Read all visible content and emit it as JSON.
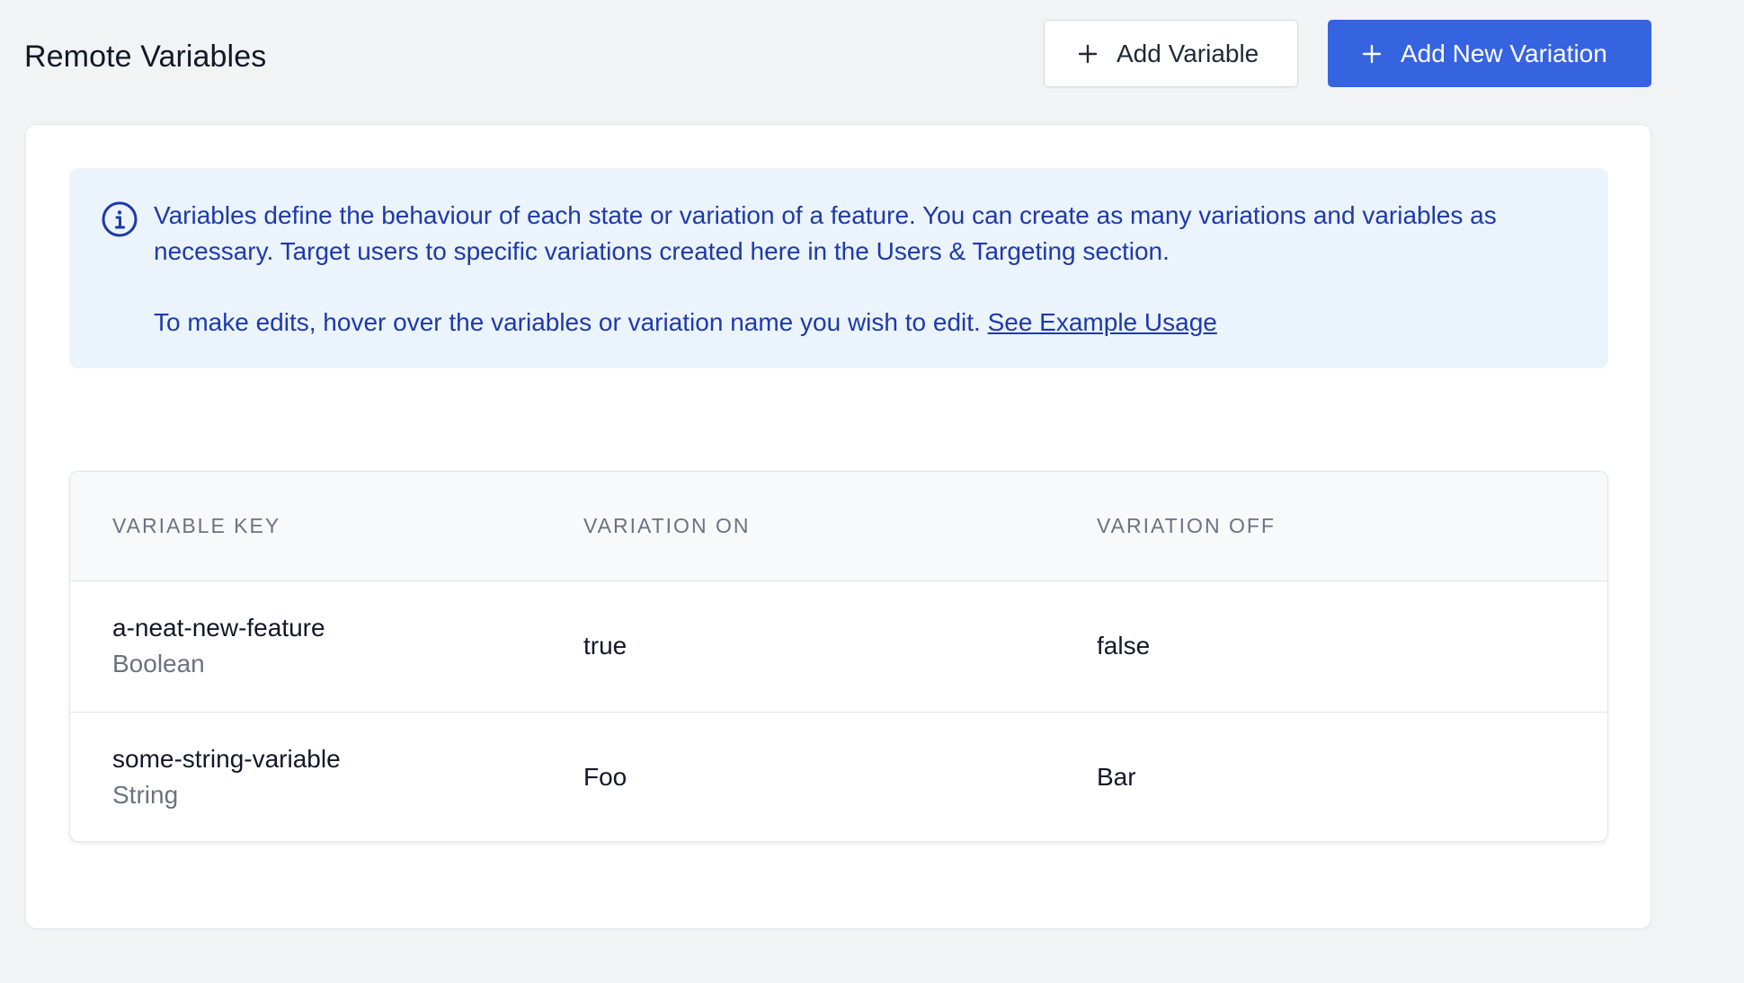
{
  "header": {
    "title": "Remote Variables",
    "add_variable_label": "Add Variable",
    "add_variation_label": "Add New Variation"
  },
  "info": {
    "text1": "Variables define the behaviour of each state or variation of a feature. You can create as many variations and variables as necessary. Target users to specific variations created here in the Users & Targeting section.",
    "text2": "To make edits, hover over the variables or variation name you wish to edit.",
    "link": "See Example Usage"
  },
  "table": {
    "columns": [
      "VARIABLE KEY",
      "VARIATION ON",
      "VARIATION OFF"
    ],
    "rows": [
      {
        "key": "a-neat-new-feature",
        "type": "Boolean",
        "on": "true",
        "off": "false"
      },
      {
        "key": "some-string-variable",
        "type": "String",
        "on": "Foo",
        "off": "Bar"
      }
    ]
  },
  "colors": {
    "primary": "#3663e0",
    "info_bg": "#ebf3fd",
    "info_text": "#1e3aa8"
  },
  "icons": [
    "plus-icon",
    "info-circle-icon"
  ]
}
